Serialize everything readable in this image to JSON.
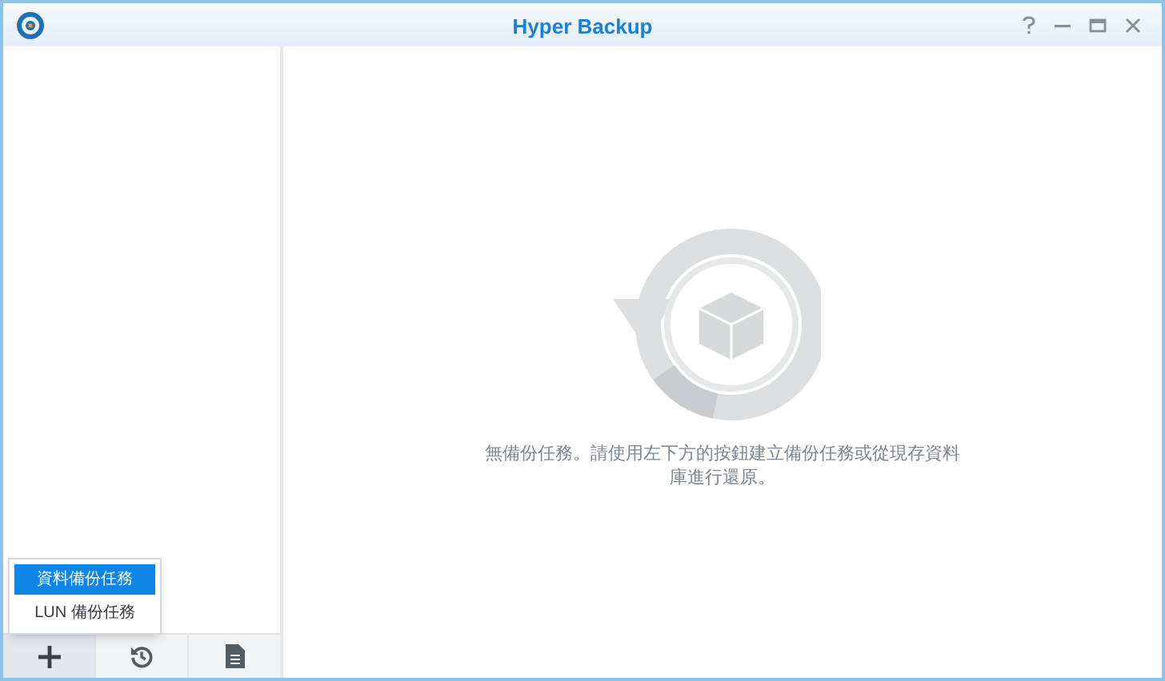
{
  "window": {
    "title": "Hyper Backup"
  },
  "empty_state": {
    "message": "無備份任務。請使用左下方的按鈕建立備份任務或從現存資料庫進行還原。"
  },
  "create_menu": {
    "items": [
      {
        "label": "資料備份任務",
        "selected": true
      },
      {
        "label": "LUN 備份任務",
        "selected": false
      }
    ]
  }
}
